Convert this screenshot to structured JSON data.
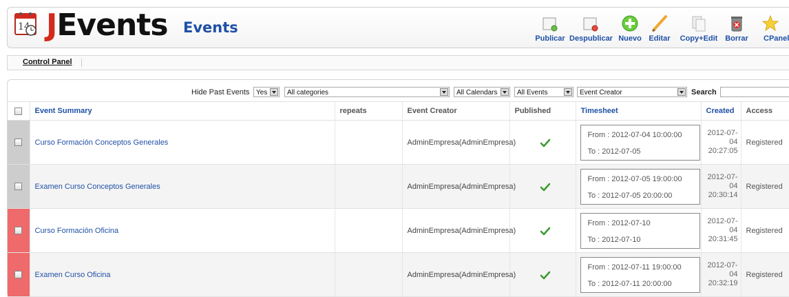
{
  "header": {
    "logo_text_rest": "Events",
    "logo_text_j": "J",
    "logo_calendar_day": "14",
    "page_title": "Events"
  },
  "toolbar": [
    {
      "id": "publish",
      "label": "Publicar",
      "icon": "publish-icon"
    },
    {
      "id": "unpublish",
      "label": "Despublicar",
      "icon": "unpublish-icon"
    },
    {
      "id": "new",
      "label": "Nuevo",
      "icon": "new-icon"
    },
    {
      "id": "edit",
      "label": "Editar",
      "icon": "edit-icon"
    },
    {
      "id": "copy_edit",
      "label": "Copy+Edit",
      "icon": "copy-icon"
    },
    {
      "id": "delete",
      "label": "Borrar",
      "icon": "delete-icon"
    },
    {
      "id": "cpanel",
      "label": "CPanel",
      "icon": "star-icon"
    }
  ],
  "breadcrumb": {
    "control_panel": "Control Panel"
  },
  "filters": {
    "hide_past_label": "Hide Past Events",
    "hide_past_value": "Yes",
    "category_value": "All categories",
    "calendar_value": "All Calendars",
    "events_value": "All Events",
    "creator_value": "Event Creator",
    "search_label": "Search",
    "search_value": ""
  },
  "table": {
    "headers": {
      "summary": "Event Summary",
      "repeats": "repeats",
      "creator": "Event Creator",
      "published": "Published",
      "timesheet": "Timesheet",
      "created": "Created",
      "access": "Access"
    },
    "rows": [
      {
        "summary": "Curso Formación Conceptos Generales",
        "repeats": "",
        "creator": "AdminEmpresa(AdminEmpresa)",
        "published": true,
        "from": "From : 2012-07-04 10:00:00",
        "to": "To : 2012-07-05",
        "created_date": "2012-07-04",
        "created_time": "20:27:05",
        "access": "Registered",
        "marker": "grey"
      },
      {
        "summary": "Examen Curso Conceptos Generales",
        "repeats": "",
        "creator": "AdminEmpresa(AdminEmpresa)",
        "published": true,
        "from": "From : 2012-07-05 19:00:00",
        "to": "To : 2012-07-05 20:00:00",
        "created_date": "2012-07-04",
        "created_time": "20:30:14",
        "access": "Registered",
        "marker": "grey"
      },
      {
        "summary": "Curso Formación Oficina",
        "repeats": "",
        "creator": "AdminEmpresa(AdminEmpresa)",
        "published": true,
        "from": "From : 2012-07-10",
        "to": "To : 2012-07-10",
        "created_date": "2012-07-04",
        "created_time": "20:31:45",
        "access": "Registered",
        "marker": "red"
      },
      {
        "summary": "Examen Curso Oficina",
        "repeats": "",
        "creator": "AdminEmpresa(AdminEmpresa)",
        "published": true,
        "from": "From : 2012-07-11 19:00:00",
        "to": "To : 2012-07-11 20:00:00",
        "created_date": "2012-07-04",
        "created_time": "20:32:19",
        "access": "Registered",
        "marker": "red"
      }
    ]
  },
  "colors": {
    "brand_red": "#d32a1e",
    "link_blue": "#1f50a6",
    "marker_grey": "#cdcdcd",
    "marker_red": "#ef6a6a",
    "published_green": "#3a9a2e"
  }
}
